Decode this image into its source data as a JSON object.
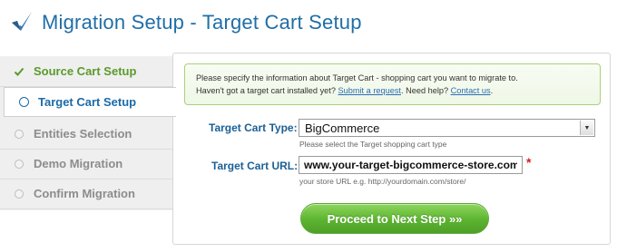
{
  "header": {
    "title": "Migration Setup - Target Cart Setup"
  },
  "steps": [
    {
      "label": "Source Cart Setup",
      "state": "done"
    },
    {
      "label": "Target Cart Setup",
      "state": "active"
    },
    {
      "label": "Entities Selection",
      "state": "pending"
    },
    {
      "label": "Demo Migration",
      "state": "pending"
    },
    {
      "label": "Confirm Migration",
      "state": "pending"
    }
  ],
  "info": {
    "line1": "Please specify the information about Target Cart - shopping cart you want to migrate to.",
    "line2_prefix": "Haven't got a target cart installed yet?",
    "submit_link": "Submit a request",
    "mid": ". Need help?",
    "contact_link": "Contact us",
    "end": "."
  },
  "form": {
    "cart_type_label": "Target Cart Type:",
    "cart_type_value": "BigCommerce",
    "cart_type_hint": "Please select the Target shopping cart type",
    "cart_url_label": "Target Cart URL:",
    "cart_url_value": "www.your-target-bigcommerce-store.com",
    "cart_url_hint": "your store URL e.g. http://yourdomain.com/store/",
    "required_mark": "*"
  },
  "button": {
    "label": "Proceed to Next Step »»"
  },
  "colors": {
    "accent": "#1f6ea7",
    "done": "#5b9a2b",
    "button": "#5cb430"
  }
}
